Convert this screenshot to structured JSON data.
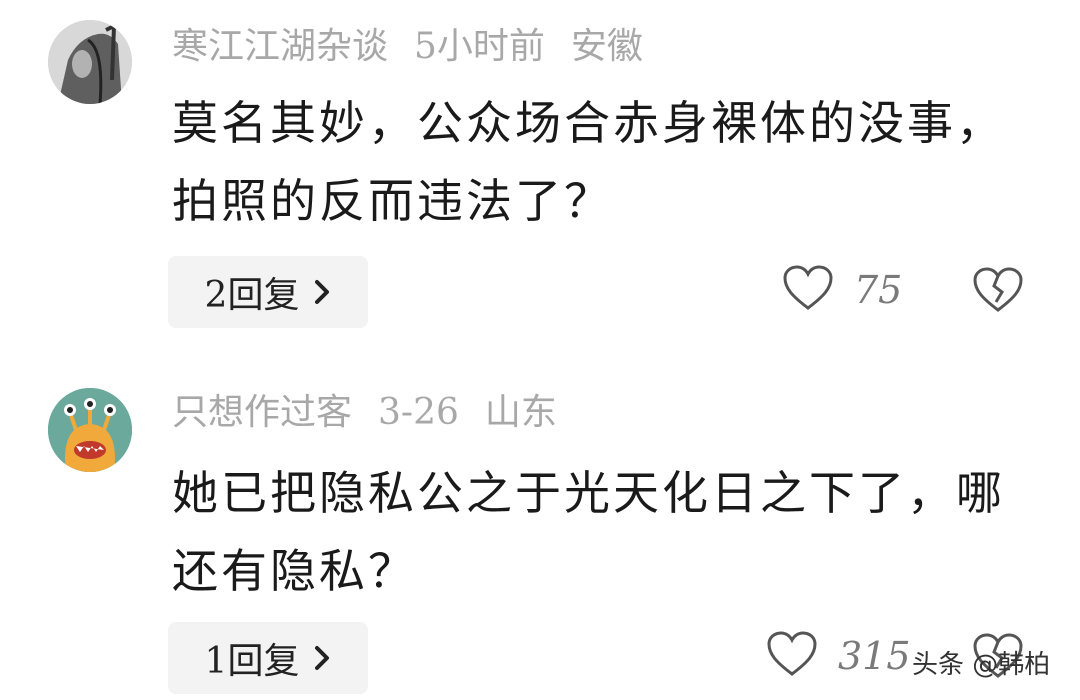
{
  "comments": [
    {
      "username": "寒江江湖杂谈",
      "time": "5小时前",
      "location": "安徽",
      "text": "莫名其妙，公众场合赤身裸体的没事，拍照的反而违法了？",
      "reply_label": "2回复",
      "likes": "75",
      "avatar": "ink-figure-avatar"
    },
    {
      "username": "只想作过客",
      "time": "3-26",
      "location": "山东",
      "text": "她已把隐私公之于光天化日之下了，哪还有隐私？",
      "reply_label": "1回复",
      "likes": "315",
      "avatar": "monster-avatar"
    }
  ],
  "watermark": "头条 @韩柏",
  "colors": {
    "meta_gray": "#a8a8a8",
    "reply_bg": "#f3f3f3",
    "avatar2_bg": "#6aa99b",
    "avatar2_monster": "#f2a93b"
  }
}
